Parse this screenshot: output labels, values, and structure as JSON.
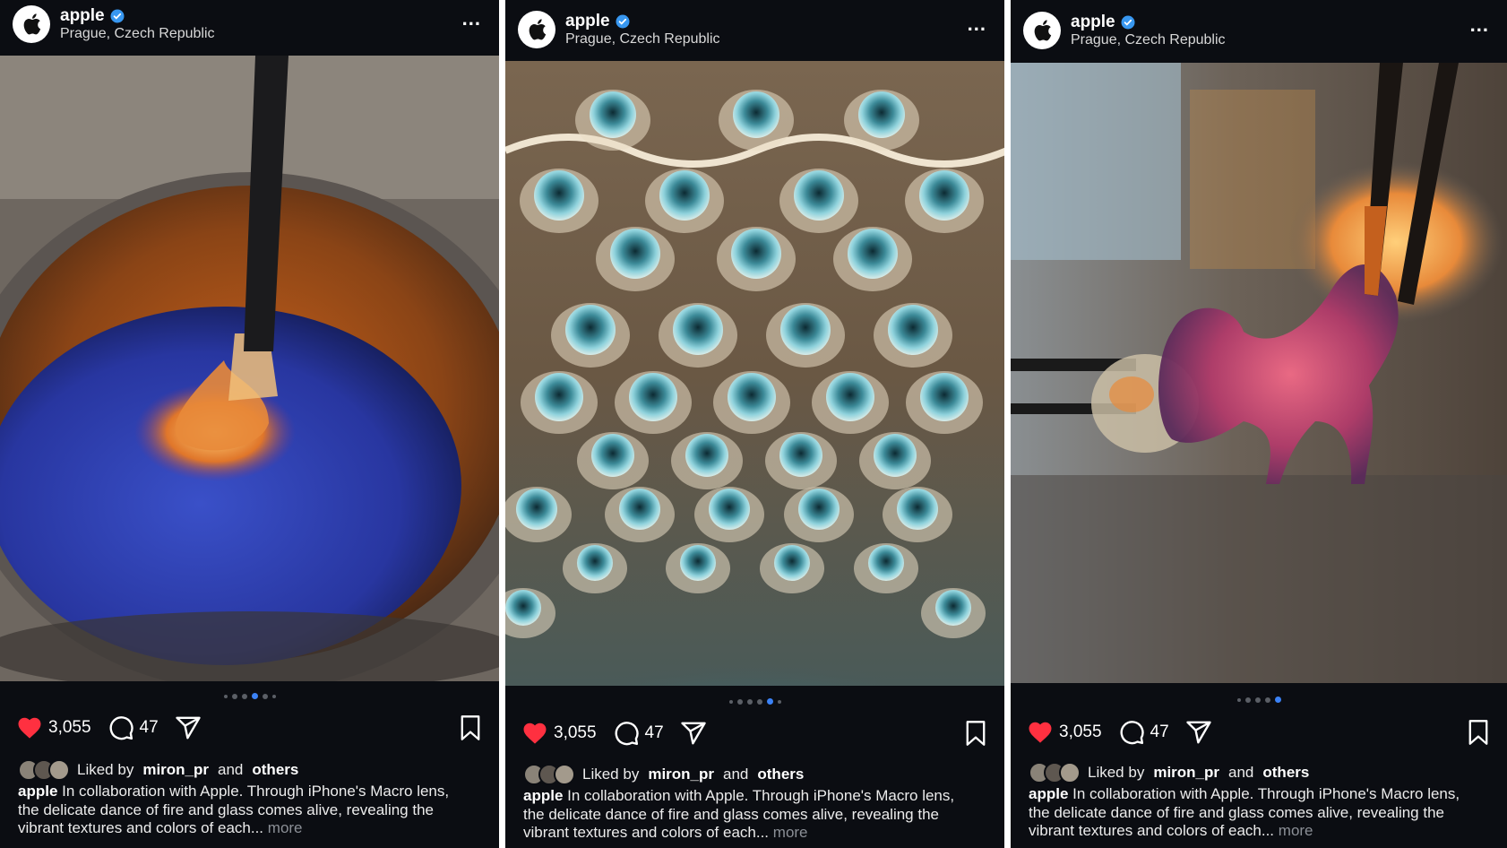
{
  "posts": [
    {
      "username": "apple",
      "location": "Prague, Czech Republic",
      "menu": "...",
      "likes": "3,055",
      "comments": "47",
      "liked_by_prefix": "Liked by",
      "liked_by_user": "miron_pr",
      "liked_by_and": "and",
      "liked_by_others": "others",
      "caption_user": "apple",
      "caption_text": "In collaboration with Apple. Through iPhone's Macro lens, the delicate dance of fire and glass comes alive, revealing the vibrant textures and colors of each...",
      "more": "more",
      "carousel_total": 6,
      "carousel_active": 4,
      "image": "glowing glass on rod in bowl of blue powder"
    },
    {
      "username": "apple",
      "location": "Prague, Czech Republic",
      "menu": "...",
      "likes": "3,055",
      "comments": "47",
      "liked_by_prefix": "Liked by",
      "liked_by_user": "miron_pr",
      "liked_by_and": "and",
      "liked_by_others": "others",
      "caption_user": "apple",
      "caption_text": "In collaboration with Apple. Through iPhone's Macro lens, the delicate dance of fire and glass comes alive, revealing the vibrant textures and colors of each...",
      "more": "more",
      "carousel_total": 6,
      "carousel_active": 5,
      "image": "close-up of textured glass with teal bubbles"
    },
    {
      "username": "apple",
      "location": "Prague, Czech Republic",
      "menu": "...",
      "likes": "3,055",
      "comments": "47",
      "liked_by_prefix": "Liked by",
      "liked_by_user": "miron_pr",
      "liked_by_and": "and",
      "liked_by_others": "others",
      "caption_user": "apple",
      "caption_text": "In collaboration with Apple. Through iPhone's Macro lens, the delicate dance of fire and glass comes alive, revealing the vibrant textures and colors of each...",
      "more": "more",
      "carousel_total": 5,
      "carousel_active": 5,
      "image": "glass horse figurine held by tongs"
    }
  ],
  "colors": {
    "background": "#0b0d12",
    "heart": "#ff3040",
    "verified": "#3897f0",
    "carousel_active": "#3b82f6",
    "more_text": "#8b8f96"
  },
  "icons": [
    "apple-logo-icon",
    "verified-badge-icon",
    "more-options-icon",
    "heart-icon",
    "comment-icon",
    "share-icon",
    "bookmark-icon"
  ]
}
